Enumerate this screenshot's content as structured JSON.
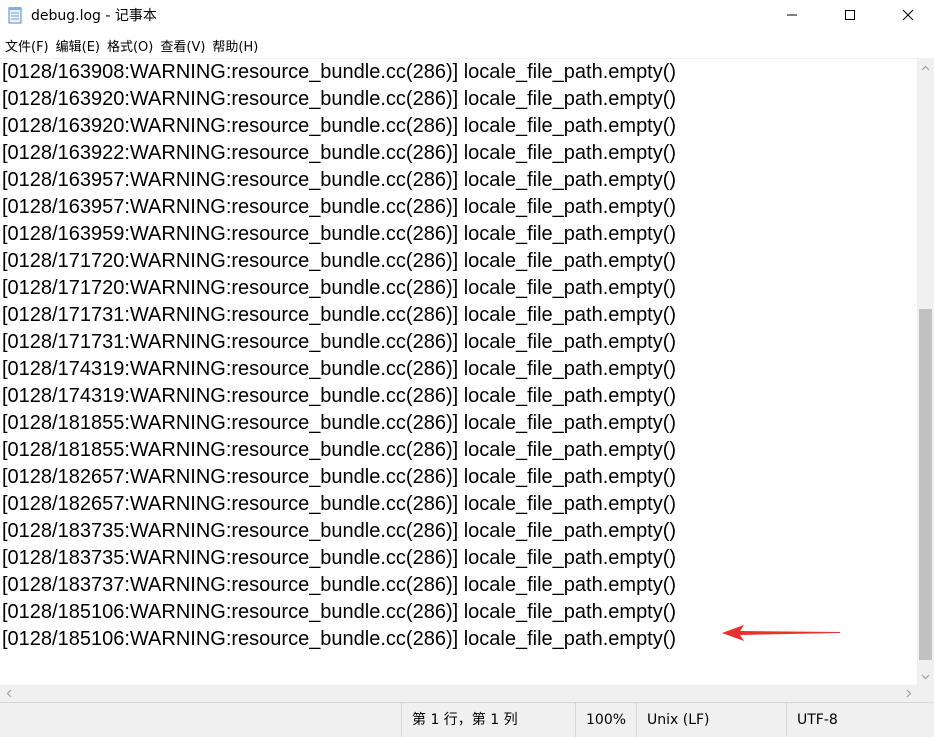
{
  "window": {
    "title": "debug.log - 记事本"
  },
  "menu": [
    {
      "label": "文件(F)"
    },
    {
      "label": "编辑(E)"
    },
    {
      "label": "格式(O)"
    },
    {
      "label": "查看(V)"
    },
    {
      "label": "帮助(H)"
    }
  ],
  "log_lines": [
    "[0128/163908:WARNING:resource_bundle.cc(286)] locale_file_path.empty()",
    "[0128/163920:WARNING:resource_bundle.cc(286)] locale_file_path.empty()",
    "[0128/163920:WARNING:resource_bundle.cc(286)] locale_file_path.empty()",
    "[0128/163922:WARNING:resource_bundle.cc(286)] locale_file_path.empty()",
    "[0128/163957:WARNING:resource_bundle.cc(286)] locale_file_path.empty()",
    "[0128/163957:WARNING:resource_bundle.cc(286)] locale_file_path.empty()",
    "[0128/163959:WARNING:resource_bundle.cc(286)] locale_file_path.empty()",
    "[0128/171720:WARNING:resource_bundle.cc(286)] locale_file_path.empty()",
    "[0128/171720:WARNING:resource_bundle.cc(286)] locale_file_path.empty()",
    "[0128/171731:WARNING:resource_bundle.cc(286)] locale_file_path.empty()",
    "[0128/171731:WARNING:resource_bundle.cc(286)] locale_file_path.empty()",
    "[0128/174319:WARNING:resource_bundle.cc(286)] locale_file_path.empty()",
    "[0128/174319:WARNING:resource_bundle.cc(286)] locale_file_path.empty()",
    "[0128/181855:WARNING:resource_bundle.cc(286)] locale_file_path.empty()",
    "[0128/181855:WARNING:resource_bundle.cc(286)] locale_file_path.empty()",
    "[0128/182657:WARNING:resource_bundle.cc(286)] locale_file_path.empty()",
    "[0128/182657:WARNING:resource_bundle.cc(286)] locale_file_path.empty()",
    "[0128/183735:WARNING:resource_bundle.cc(286)] locale_file_path.empty()",
    "[0128/183735:WARNING:resource_bundle.cc(286)] locale_file_path.empty()",
    "[0128/183737:WARNING:resource_bundle.cc(286)] locale_file_path.empty()",
    "[0128/185106:WARNING:resource_bundle.cc(286)] locale_file_path.empty()",
    "[0128/185106:WARNING:resource_bundle.cc(286)] locale_file_path.empty()"
  ],
  "status": {
    "position": "第 1 行，第 1 列",
    "zoom": "100%",
    "line_ending": "Unix (LF)",
    "encoding": "UTF-8"
  },
  "colors": {
    "annotation_arrow": "#e8312f",
    "scrollbar_thumb": "#c1c1c1",
    "chrome_bg": "#f0f0f0"
  },
  "icons": {
    "app": "notepad-icon",
    "minimize": "minimize-icon",
    "maximize": "maximize-icon",
    "close": "close-icon"
  }
}
